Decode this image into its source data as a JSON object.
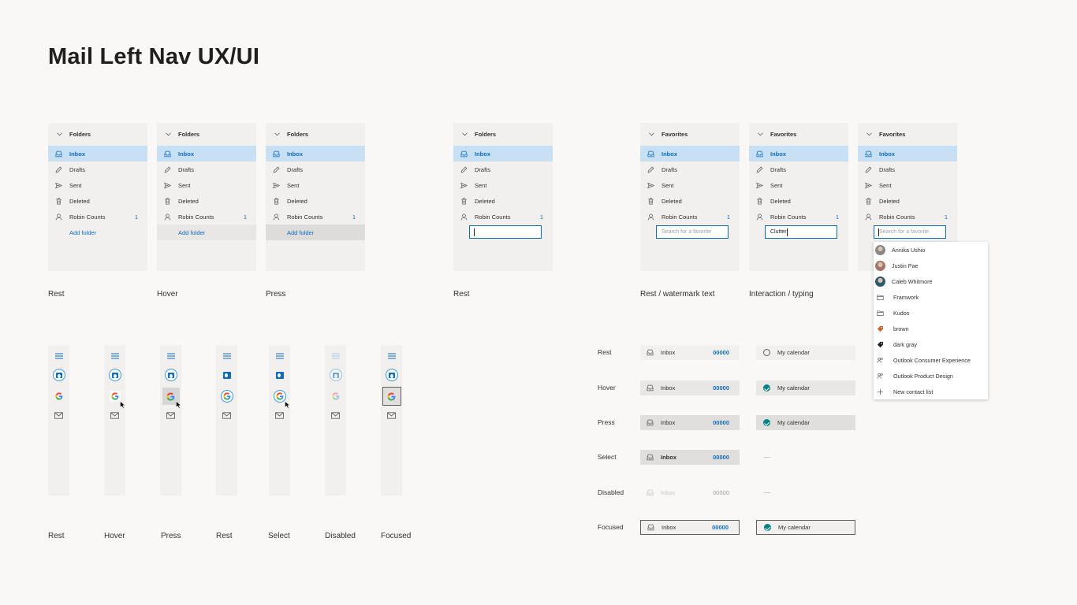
{
  "title": "Mail Left Nav UX/UI",
  "colors": {
    "accent": "#0f6cbd",
    "selected_bg": "#c7e0f4",
    "calendar_green": "#038387",
    "panel_bg": "#f1f0ef"
  },
  "folders_header": "Folders",
  "favorites_header": "Favorites",
  "nav_items": {
    "inbox": "Inbox",
    "drafts": "Drafts",
    "sent": "Sent",
    "deleted": "Deleted",
    "robin": "Robin Counts",
    "robin_count": "1",
    "add_folder": "Add folder"
  },
  "search": {
    "placeholder": "Search for a favorite",
    "typed": "Clutter"
  },
  "panel_labels": {
    "rest": "Rest",
    "hover": "Hover",
    "press": "Press",
    "rest2": "Rest",
    "watermark": "Rest / watermark text",
    "typing": "Interaction / typing"
  },
  "dropdown_items": [
    {
      "label": "Annika Ushio",
      "icon": "avatar"
    },
    {
      "label": "Justin Pae",
      "icon": "avatar"
    },
    {
      "label": "Caleb Whitmore",
      "icon": "avatar"
    },
    {
      "label": "Framwork",
      "icon": "folder-icon"
    },
    {
      "label": "Kudos",
      "icon": "folder-icon"
    },
    {
      "label": "brown",
      "icon": "tag-icon",
      "color": "#c9602b"
    },
    {
      "label": "dark gray",
      "icon": "tag-icon",
      "color": "#201f1e"
    },
    {
      "label": "Outlook Consumer Experience",
      "icon": "group-icon"
    },
    {
      "label": "Outlook Product Design",
      "icon": "group-icon"
    },
    {
      "label": "New contact list",
      "icon": "plus-icon"
    }
  ],
  "rail_labels": [
    "Rest",
    "Hover",
    "Press",
    "Rest",
    "Select",
    "Disabled",
    "Focused"
  ],
  "states": {
    "labels": [
      "Rest",
      "Hover",
      "Press",
      "Select",
      "Disabled",
      "Focused"
    ],
    "inbox": "Inbox",
    "count": "00000",
    "calendar": "My calendar"
  }
}
